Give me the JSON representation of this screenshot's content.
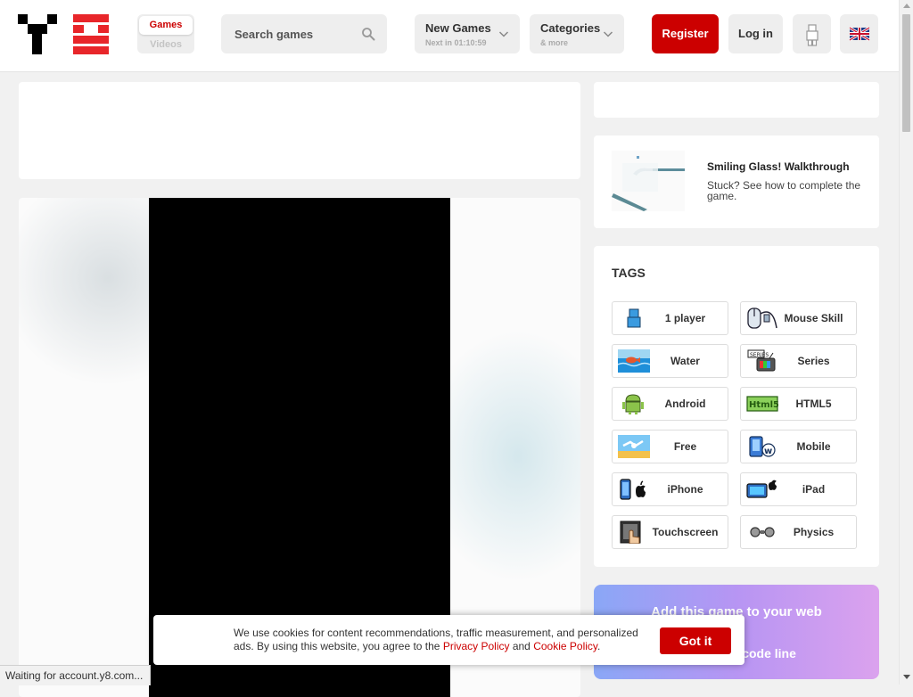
{
  "header": {
    "mode_switch": {
      "games": "Games",
      "videos": "Videos"
    },
    "search": {
      "placeholder": "Search games",
      "icon": "search-icon"
    },
    "new_games": {
      "title": "New Games",
      "subtitle": "Next in 01:10:59"
    },
    "categories": {
      "title": "Categories",
      "subtitle": "& more"
    },
    "register": "Register",
    "login": "Log in",
    "user_icon": "person-icon",
    "language_icon": "uk-flag-icon"
  },
  "walkthrough": {
    "title": "Smiling Glass! Walkthrough",
    "description": "Stuck? See how to complete the game."
  },
  "tags": {
    "heading": "TAGS",
    "items": [
      {
        "label": "1 player",
        "icon": "player-icon"
      },
      {
        "label": "Mouse Skill",
        "icon": "mouse-icon"
      },
      {
        "label": "Water",
        "icon": "water-icon"
      },
      {
        "label": "Series",
        "icon": "tv-series-icon"
      },
      {
        "label": "Android",
        "icon": "android-icon"
      },
      {
        "label": "HTML5",
        "icon": "html5-icon"
      },
      {
        "label": "Free",
        "icon": "free-icon"
      },
      {
        "label": "Mobile",
        "icon": "mobile-icon"
      },
      {
        "label": "iPhone",
        "icon": "iphone-icon"
      },
      {
        "label": "iPad",
        "icon": "ipad-icon"
      },
      {
        "label": "Touchscreen",
        "icon": "touchscreen-icon"
      },
      {
        "label": "Physics",
        "icon": "physics-icon"
      }
    ]
  },
  "promo": {
    "line1": "Add this game to your web",
    "line2": "the simple code line"
  },
  "cookie": {
    "text_before": "We use cookies for content recommendations, traffic measurement, and personalized ads. By using this website, you agree to the ",
    "privacy_link": "Privacy Policy",
    "and": " and ",
    "cookie_link": "Cookie Policy",
    "period": ".",
    "button": "Got it"
  },
  "status_bar": "Waiting for account.y8.com...",
  "colors": {
    "brand_red": "#cc0000",
    "page_bg": "#f1f1f1",
    "control_bg": "#eeeeee"
  }
}
